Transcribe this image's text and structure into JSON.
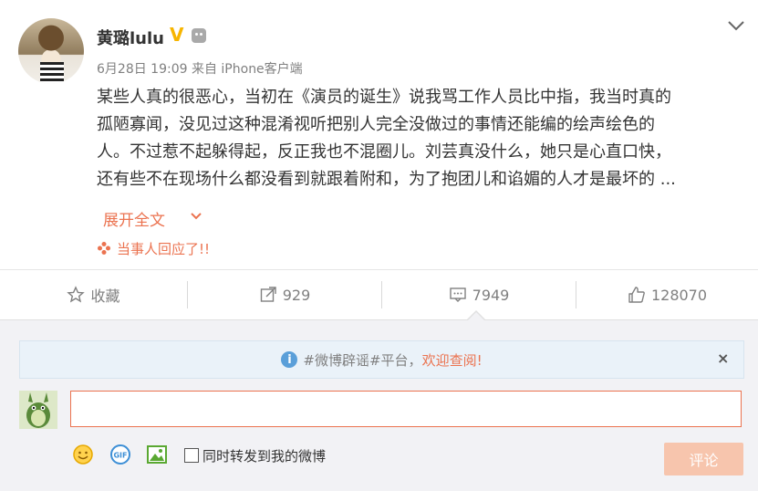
{
  "post": {
    "username": "黄璐lulu",
    "verified_badge": "V",
    "meta": "6月28日 19:09 来自 iPhone客户端",
    "content": "某些人真的很恶心，当初在《演员的诞生》说我骂工作人员比中指，我当时真的孤陋寡闻，没见过这种混淆视听把别人完全没做过的事情还能编的绘声绘色的人。不过惹不起躲得起，反正我也不混圈儿。刘芸真没什么，她只是心直口快，还有些不在现场什么都没看到就跟着附和，为了抱团儿和谄媚的人才是最坏的 ...",
    "content_lines": [
      "某些人真的很恶心，当初在《演员的诞生》说我骂工作人员比中指，我当时真的",
      "孤陋寡闻，没见过这种混淆视听把别人完全没做过的事情还能编的绘声绘色的",
      "人。不过惹不起躲得起，反正我也不混圈儿。刘芸真没什么，她只是心直口快，",
      "还有些不在现场什么都没看到就跟着附和，为了抱团儿和谄媚的人才是最坏的 ..."
    ],
    "expand_label": "展开全文",
    "reply_note": "当事人回应了!!"
  },
  "actions": {
    "favorite_label": "收藏",
    "repost_count": "929",
    "comment_count": "7949",
    "like_count": "128070"
  },
  "comment_box": {
    "notice_prefix": "#微博辟谣#平台，",
    "notice_link": "欢迎查阅!",
    "notice_close": "×",
    "input_value": "",
    "forward_label": "同时转发到我的微博",
    "submit_label": "评论"
  },
  "colors": {
    "accent": "#eb7350",
    "verified": "#f7b500",
    "submit_disabled": "#f7c5ad",
    "notice_bg": "#eaf2f9",
    "info_icon": "#5a9fd9"
  },
  "icons": [
    "chevron-down-icon",
    "star-icon",
    "repost-icon",
    "comment-icon",
    "thumbs-up-icon",
    "info-icon",
    "emoji-icon",
    "gif-icon",
    "image-icon",
    "flower-icon",
    "robot-icon"
  ]
}
